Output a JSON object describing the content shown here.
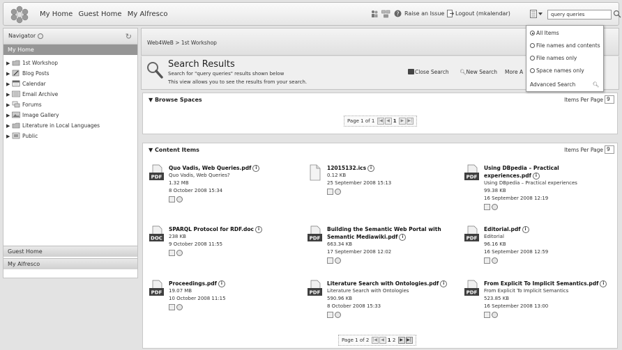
{
  "header": {
    "nav": [
      "My Home",
      "Guest Home",
      "My Alfresco"
    ],
    "raise_issue": "Raise an Issue",
    "logout": "Logout (mkalendar)",
    "search_value": "query queries"
  },
  "search_menu": {
    "options": [
      "All Items",
      "File names and contents",
      "File names only",
      "Space names only"
    ],
    "selected": "All Items",
    "advanced": "Advanced Search"
  },
  "sidebar": {
    "navigator_label": "Navigator",
    "current": "My Home",
    "items": [
      {
        "label": "1st Workshop",
        "icon": "workshop-space-icon"
      },
      {
        "label": "Blog Posts",
        "icon": "blog-icon"
      },
      {
        "label": "Calendar",
        "icon": "calendar-icon"
      },
      {
        "label": "Email Archive",
        "icon": "email-archive-icon"
      },
      {
        "label": "Forums",
        "icon": "forums-icon"
      },
      {
        "label": "Image Gallery",
        "icon": "image-gallery-icon"
      },
      {
        "label": "Literature in Local Languages",
        "icon": "literature-space-icon"
      },
      {
        "label": "Public",
        "icon": "public-space-icon"
      }
    ],
    "bottom_tabs": [
      "Guest Home",
      "My Alfresco"
    ]
  },
  "breadcrumb": "Web4WeB > 1st Workshop",
  "results": {
    "title": "Search Results",
    "desc1": "Search for \"query queries\" results shown below",
    "desc2": "This view allows you to see the results from your search.",
    "close_search": "Close Search",
    "new_search": "New Search",
    "more_actions": "More A"
  },
  "browse_spaces": {
    "title": "Browse Spaces",
    "items_per_page_label": "Items Per Page",
    "items_per_page": "9",
    "page_label": "Page 1 of 1",
    "current_page": "1"
  },
  "content_items": {
    "title": "Content Items",
    "items_per_page_label": "Items Per Page",
    "items_per_page": "9",
    "page_label": "Page 1 of 2",
    "pages": [
      "1",
      "2"
    ],
    "items": [
      {
        "name": "Quo Vadis, Web Queries.pdf",
        "icon": "pdf-icon",
        "lines": [
          "Quo Vadis, Web Queries?",
          "1.32 MB",
          "8 October 2008 15:34"
        ]
      },
      {
        "name": "12015132.ics",
        "icon": "generic-file-icon",
        "lines": [
          "0.12 KB",
          "25 September 2008 15:13"
        ]
      },
      {
        "name": "Using DBpedia – Practical experiences.pdf",
        "icon": "pdf-icon",
        "lines": [
          "Using DBpedia – Practical experiences",
          "99.38 KB",
          "16 September 2008 12:19"
        ]
      },
      {
        "name": "SPARQL Protocol for RDF.doc",
        "icon": "doc-icon",
        "lines": [
          "238 KB",
          "9 October 2008 11:55"
        ]
      },
      {
        "name": "Building the Semantic Web Portal with Semantic Mediawiki.pdf",
        "icon": "pdf-icon",
        "lines": [
          "663.34 KB",
          "17 September 2008 12:02"
        ]
      },
      {
        "name": "Editorial.pdf",
        "icon": "pdf-icon",
        "lines": [
          "Editorial",
          "96.16 KB",
          "16 September 2008 12:59"
        ]
      },
      {
        "name": "Proceedings.pdf",
        "icon": "pdf-icon",
        "lines": [
          "19.07 MB",
          "10 October 2008 11:15"
        ]
      },
      {
        "name": "Literature Search with Ontologies.pdf",
        "icon": "pdf-icon",
        "lines": [
          "Literature Search with Ontologies",
          "590.96 KB",
          "8 October 2008 15:33"
        ]
      },
      {
        "name": "From Explicit To Implicit Semantics.pdf",
        "icon": "pdf-icon",
        "lines": [
          "From Explicit To Implicit Semantics",
          "523.85 KB",
          "16 September 2008 13:00"
        ]
      }
    ]
  },
  "icon_glyphs": {
    "info": "i",
    "pdf": "PDF",
    "doc": "DOC",
    "expand": "▶",
    "collapse": "▼"
  }
}
